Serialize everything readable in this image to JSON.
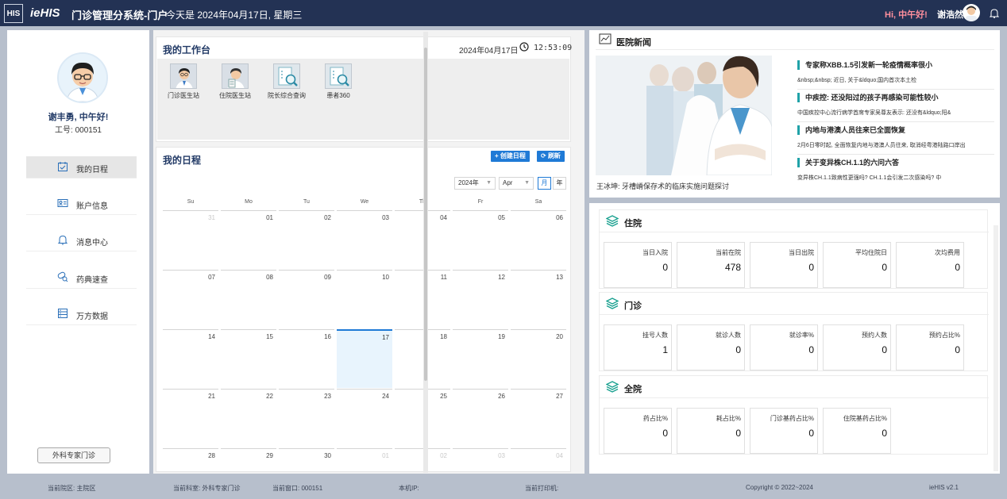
{
  "header": {
    "logo_text": "HIS",
    "brand": "ieHIS",
    "system_title": "门诊管理分系统-门户",
    "today_text": "今天是  2024年04月17日,  星期三",
    "greeting": "Hi, 中午好!",
    "user_name": "谢浩然"
  },
  "profile": {
    "greeting": "谢丰勇, 中午好!",
    "job_no": "工号: 000151"
  },
  "nav": [
    {
      "label": "我的日程",
      "icon": "calendar-check-icon"
    },
    {
      "label": "账户信息",
      "icon": "id-card-icon"
    },
    {
      "label": "消息中心",
      "icon": "bell-icon"
    },
    {
      "label": "药典速查",
      "icon": "pill-search-icon"
    },
    {
      "label": "万方数据",
      "icon": "database-icon"
    }
  ],
  "dept_button": "外科专家门诊",
  "workbench": {
    "title": "我的工作台",
    "date": "2024年04月17日",
    "time": "12:53:09",
    "apps": [
      {
        "label": "门诊医生站"
      },
      {
        "label": "住院医生站"
      },
      {
        "label": "院长综合查询"
      },
      {
        "label": "患者360"
      }
    ]
  },
  "schedule": {
    "title": "我的日程",
    "create_btn": "创建日程",
    "refresh_btn": "刷新",
    "year_select": "2024年",
    "month_select": "Apr",
    "view_month": "月",
    "view_year": "年",
    "weekdays": [
      "Su",
      "Mo",
      "Tu",
      "We",
      "Th",
      "Fr",
      "Sa"
    ],
    "days": [
      "31",
      "01",
      "02",
      "03",
      "04",
      "05",
      "06",
      "07",
      "08",
      "09",
      "10",
      "11",
      "12",
      "13",
      "14",
      "15",
      "16",
      "17",
      "18",
      "19",
      "20",
      "21",
      "22",
      "23",
      "24",
      "25",
      "26",
      "27",
      "28",
      "29",
      "30",
      "01",
      "02",
      "03",
      "04"
    ]
  },
  "news": {
    "title": "医院新闻",
    "caption": "王冰坤: 牙槽嵴保存术的临床实施问题探讨",
    "items": [
      {
        "title": "专家称XBB.1.5引发新一轮疫情概率很小",
        "summary": "&nbsp;&nbsp; 近日, 关于&ldquo;国内首次本土检"
      },
      {
        "title": "中疾控: 还没阳过的孩子再感染可能性较小",
        "summary": "中国疾控中心流行病学首席专家吴尊友表示: 还没有&ldquo;阳&"
      },
      {
        "title": "内地与港澳人员往来已全面恢复",
        "summary": "2月6日零时起, 全面恢复内地与港澳人员往来, 取消经粤港陆路口岸出"
      },
      {
        "title": "关于变异株CH.1.1的六问六答",
        "summary": "变异株CH.1.1致病性更强吗? CH.1.1会引发二次感染吗? 中"
      }
    ]
  },
  "stats": {
    "inpatient": {
      "title": "住院",
      "cards": [
        {
          "label": "当日入院",
          "value": "0"
        },
        {
          "label": "当前在院",
          "value": "478"
        },
        {
          "label": "当日出院",
          "value": "0"
        },
        {
          "label": "平均住院日",
          "value": "0"
        },
        {
          "label": "次均费用",
          "value": "0"
        }
      ]
    },
    "outpatient": {
      "title": "门诊",
      "cards": [
        {
          "label": "挂号人数",
          "value": "1"
        },
        {
          "label": "就诊人数",
          "value": "0"
        },
        {
          "label": "就诊率%",
          "value": "0"
        },
        {
          "label": "预约人数",
          "value": "0"
        },
        {
          "label": "预约占比%",
          "value": "0"
        }
      ]
    },
    "hospital": {
      "title": "全院",
      "cards": [
        {
          "label": "药占比%",
          "value": "0"
        },
        {
          "label": "耗占比%",
          "value": "0"
        },
        {
          "label": "门诊基药占比%",
          "value": "0"
        },
        {
          "label": "住院基药占比%",
          "value": "0"
        }
      ]
    }
  },
  "footer": {
    "campus": "当前院区: 主院区",
    "dept": "当前科室: 外科专家门诊",
    "window": "当前窗口: 000151",
    "ip": "本机IP:",
    "printer": "当前打印机:",
    "copyright": "Copyright © 2022~2024",
    "version": "ieHIS v2.1"
  }
}
